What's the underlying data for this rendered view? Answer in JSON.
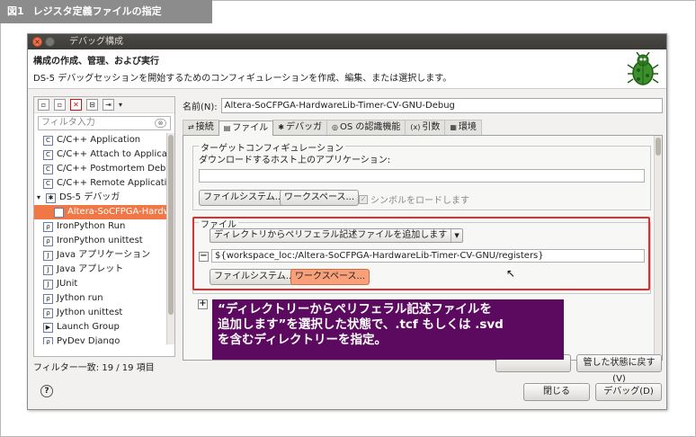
{
  "figure": {
    "label": "図1",
    "title": "レジスタ定義ファイルの指定"
  },
  "window": {
    "title": "デバッグ構成",
    "header_title": "構成の作成、管理、および実行",
    "header_desc": "DS-5 デバッグセッションを開始するためのコンフィギュレーションを作成、編集、または選択します。"
  },
  "left_panel": {
    "filter_placeholder": "フィルタ入力",
    "items": [
      {
        "label": "C/C++ Application",
        "icon": "c-icon",
        "indent": 1,
        "selected": false
      },
      {
        "label": "C/C++ Attach to Applicatio",
        "icon": "c-icon",
        "indent": 1,
        "selected": false
      },
      {
        "label": "C/C++ Postmortem Debugg",
        "icon": "c-icon",
        "indent": 1,
        "selected": false
      },
      {
        "label": "C/C++ Remote Application",
        "icon": "c-icon",
        "indent": 1,
        "selected": false
      },
      {
        "label": "DS-5 デバッガ",
        "icon": "bug-icon",
        "indent": 0,
        "selected": false,
        "expanded": true
      },
      {
        "label": "Altera-SoCFPGA-Hardwa",
        "icon": "bug-icon",
        "indent": 2,
        "selected": true
      },
      {
        "label": "IronPython Run",
        "icon": "python-icon",
        "indent": 1,
        "selected": false
      },
      {
        "label": "IronPython unittest",
        "icon": "python-icon",
        "indent": 1,
        "selected": false
      },
      {
        "label": "Java アプリケーション",
        "icon": "java-icon",
        "indent": 1,
        "selected": false
      },
      {
        "label": "Java アプレット",
        "icon": "java-icon",
        "indent": 1,
        "selected": false
      },
      {
        "label": "JUnit",
        "icon": "junit-icon",
        "indent": 1,
        "selected": false
      },
      {
        "label": "Jython run",
        "icon": "python-icon",
        "indent": 1,
        "selected": false
      },
      {
        "label": "Jython unittest",
        "icon": "python-icon",
        "indent": 1,
        "selected": false
      },
      {
        "label": "Launch Group",
        "icon": "launch-icon",
        "indent": 1,
        "selected": false
      },
      {
        "label": "PyDev Django",
        "icon": "python-icon",
        "indent": 1,
        "selected": false
      }
    ],
    "status": "フィルター一致: 19 / 19 項目"
  },
  "right_panel": {
    "name_label": "名前(N):",
    "name_value": "Altera-SoCFPGA-HardwareLib-Timer-CV-GNU-Debug",
    "tabs": [
      {
        "label": "接続",
        "icon": "connect-icon",
        "active": false
      },
      {
        "label": "ファイル",
        "icon": "file-icon",
        "active": true
      },
      {
        "label": "デバッガ",
        "icon": "bug-icon",
        "active": false
      },
      {
        "label": "OS の認識機能",
        "icon": "os-icon",
        "active": false
      },
      {
        "label": "引数",
        "icon": "args-icon",
        "active": false
      },
      {
        "label": "環境",
        "icon": "env-icon",
        "active": false
      }
    ],
    "target_group": {
      "title": "ターゲットコンフィギュレーション",
      "download_label": "ダウンロードするホスト上のアプリケーション:",
      "download_value": "",
      "fs_button": "ファイルシステム...",
      "ws_button": "ワークスペース...",
      "load_symbols": "シンボルをロードします"
    },
    "files_group": {
      "title": "ファイル",
      "combo_value": "ディレクトリからペリフェラル記述ファイルを追加します",
      "collapse": "−",
      "path_value": "${workspace_loc:/Altera-SoCFPGA-HardwareLib-Timer-CV-GNU/registers}",
      "fs_button": "ファイルシステム...",
      "ws_button": "ワークスペース...",
      "add": "+"
    },
    "revert_button": "管した状態に戻す(V)"
  },
  "footer": {
    "help": "?",
    "close_button": "閉じる",
    "debug_button": "デバッグ(D)"
  },
  "callout": {
    "line1": "“ディレクトリーからペリフェラル記述ファイルを",
    "line2": "追加します”を選択した状態で、.tcf もしくは .svd",
    "line3": "を含むディレクトリーを指定。"
  }
}
